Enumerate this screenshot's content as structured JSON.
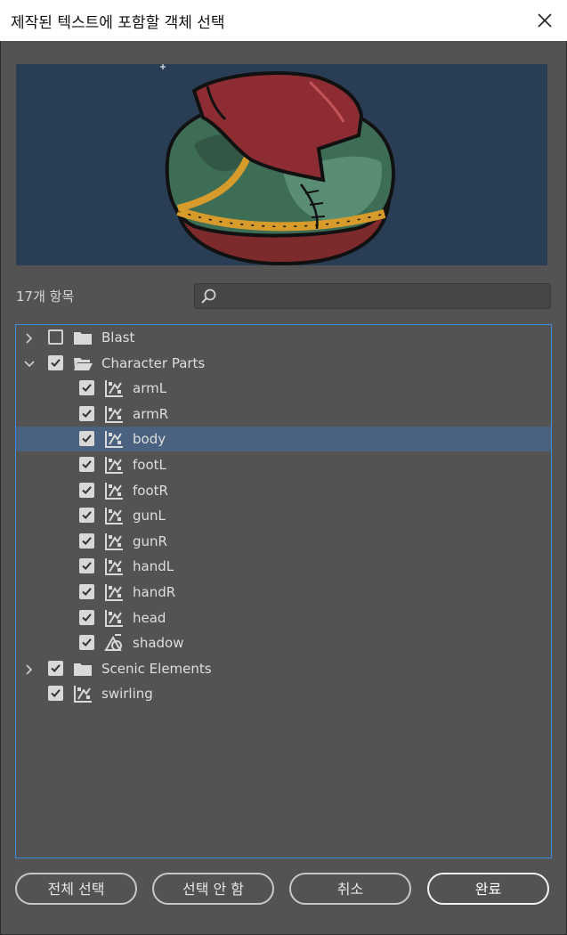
{
  "dialog": {
    "title": "제작된 텍스트에 포함할 객체 선택"
  },
  "list": {
    "item_count": "17개 항목",
    "search_placeholder": "",
    "search_value": ""
  },
  "tree": [
    {
      "label": "Blast",
      "level": 0,
      "type": "folder",
      "expanded": false,
      "checked": false,
      "selected": false
    },
    {
      "label": "Character Parts",
      "level": 0,
      "type": "folder",
      "expanded": true,
      "checked": true,
      "selected": false
    },
    {
      "label": "armL",
      "level": 1,
      "type": "symbol",
      "checked": true,
      "selected": false
    },
    {
      "label": "armR",
      "level": 1,
      "type": "symbol",
      "checked": true,
      "selected": false
    },
    {
      "label": "body",
      "level": 1,
      "type": "symbol",
      "checked": true,
      "selected": true
    },
    {
      "label": "footL",
      "level": 1,
      "type": "symbol",
      "checked": true,
      "selected": false
    },
    {
      "label": "footR",
      "level": 1,
      "type": "symbol",
      "checked": true,
      "selected": false
    },
    {
      "label": "gunL",
      "level": 1,
      "type": "symbol",
      "checked": true,
      "selected": false
    },
    {
      "label": "gunR",
      "level": 1,
      "type": "symbol",
      "checked": true,
      "selected": false
    },
    {
      "label": "handL",
      "level": 1,
      "type": "symbol",
      "checked": true,
      "selected": false
    },
    {
      "label": "handR",
      "level": 1,
      "type": "symbol",
      "checked": true,
      "selected": false
    },
    {
      "label": "head",
      "level": 1,
      "type": "symbol",
      "checked": true,
      "selected": false
    },
    {
      "label": "shadow",
      "level": 1,
      "type": "shape",
      "checked": true,
      "selected": false
    },
    {
      "label": "Scenic Elements",
      "level": 0,
      "type": "folder",
      "expanded": false,
      "checked": true,
      "selected": false
    },
    {
      "label": "swirling",
      "level": 0,
      "type": "symbol",
      "checked": true,
      "selected": false
    }
  ],
  "buttons": {
    "select_all": "전체 선택",
    "select_none": "선택 안 함",
    "cancel": "취소",
    "done": "완료"
  },
  "colors": {
    "panel_bg": "#535353",
    "preview_bg": "#293d55",
    "selection": "#4a6280",
    "focus_border": "#3f8fd6"
  }
}
